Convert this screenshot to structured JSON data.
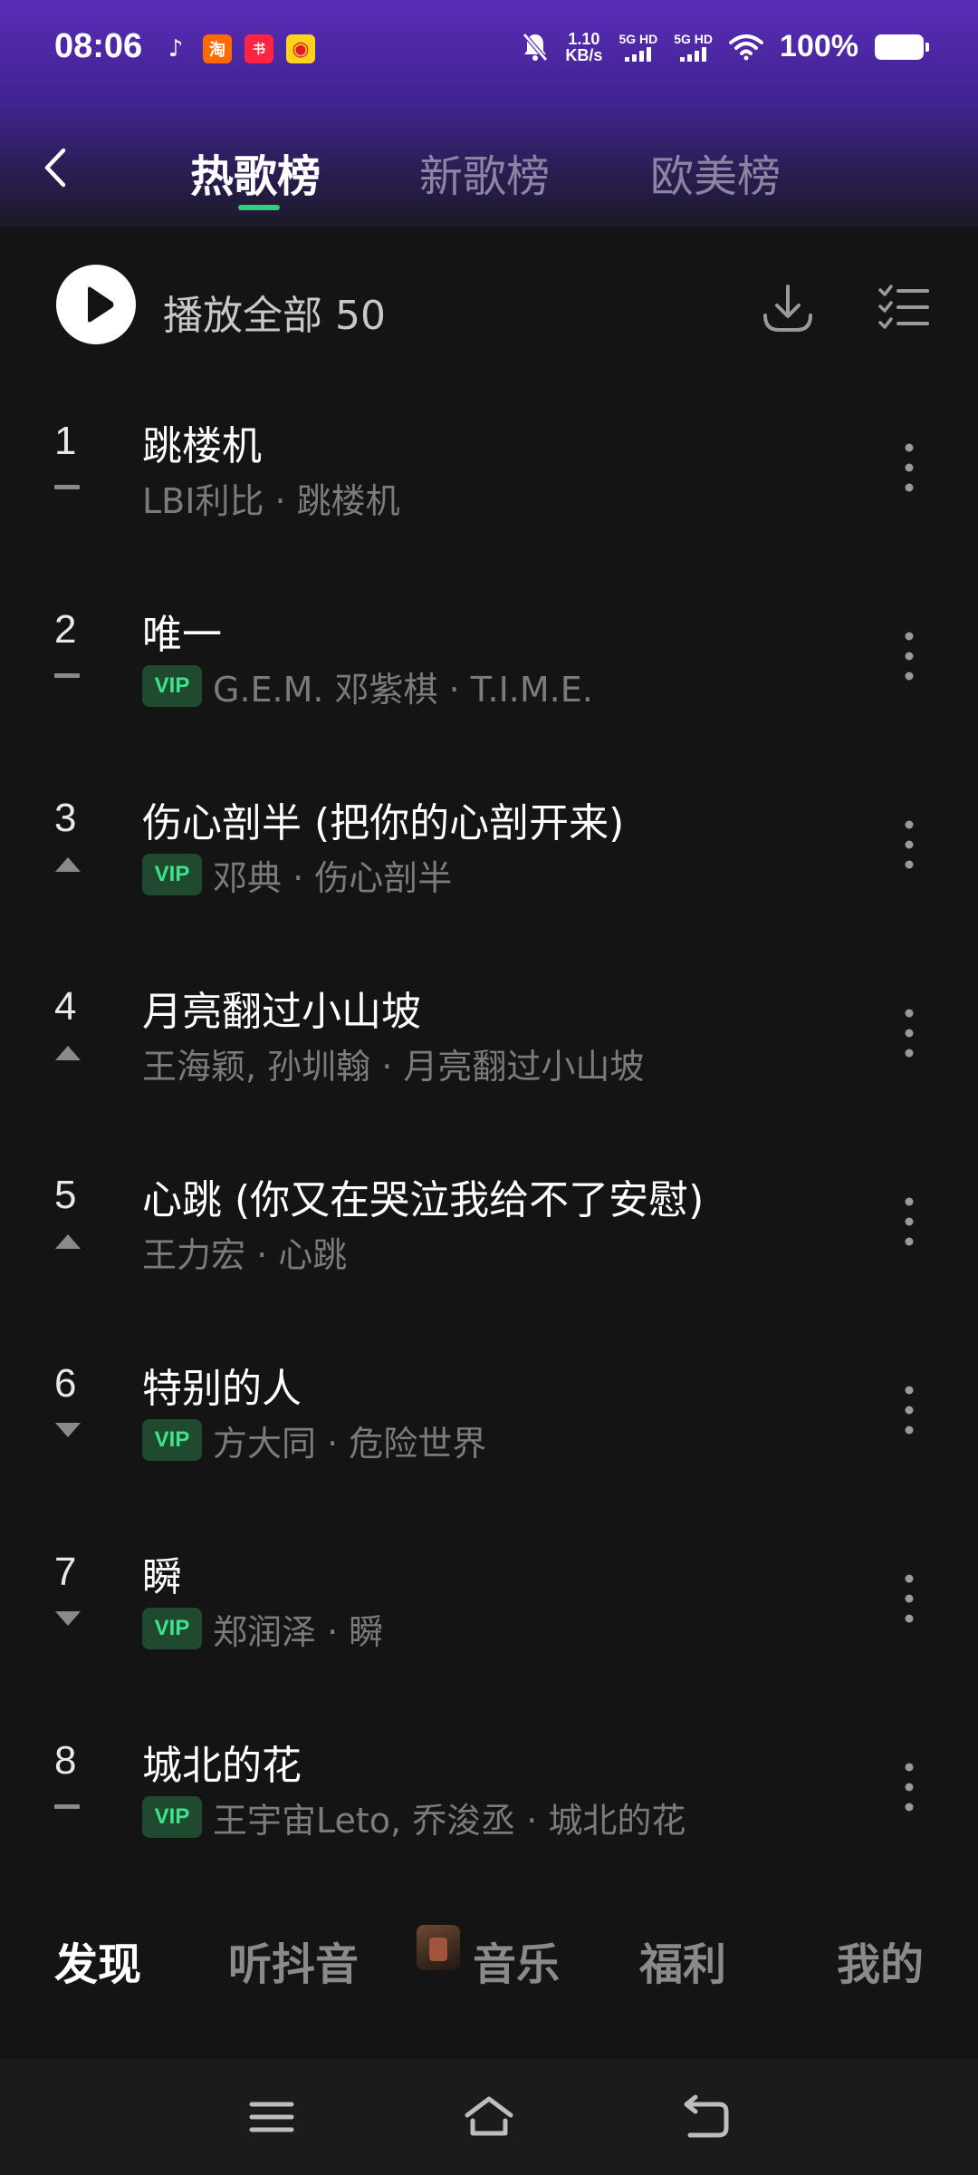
{
  "status_bar": {
    "time": "08:06",
    "apps": [
      {
        "name": "tiktok-icon",
        "glyph": "♪",
        "bg": "transparent",
        "color": "#ffffff"
      },
      {
        "name": "taobao-icon",
        "glyph": "淘",
        "bg": "#ff6a00",
        "color": "#ffffff"
      },
      {
        "name": "xiaohongshu-icon",
        "glyph": "书",
        "bg": "#ff2442",
        "color": "#ffffff"
      },
      {
        "name": "weibo-icon",
        "glyph": "◉",
        "bg": "#ffd21e",
        "color": "#e6162d"
      }
    ],
    "speed_value": "1.10",
    "speed_unit": "KB/s",
    "sim1": "5G HD",
    "sim2": "5G HD",
    "battery": "100%"
  },
  "tabs": [
    {
      "label": "热歌榜",
      "active": true
    },
    {
      "label": "新歌榜",
      "active": false
    },
    {
      "label": "欧美榜",
      "active": false
    }
  ],
  "play_all": {
    "label": "播放全部 50"
  },
  "songs": [
    {
      "rank": "1",
      "title": "跳楼机",
      "vip": false,
      "artist": "LBI利比 · 跳楼机",
      "trend": "flat"
    },
    {
      "rank": "2",
      "title": "唯一",
      "vip": true,
      "artist": "G.E.M. 邓紫棋 · T.I.M.E.",
      "trend": "flat"
    },
    {
      "rank": "3",
      "title": "伤心剖半 (把你的心剖开来)",
      "vip": true,
      "artist": "邓典 · 伤心剖半",
      "trend": "up"
    },
    {
      "rank": "4",
      "title": "月亮翻过小山坡",
      "vip": false,
      "artist": "王海颖, 孙圳翰 · 月亮翻过小山坡",
      "trend": "up"
    },
    {
      "rank": "5",
      "title": "心跳 (你又在哭泣我给不了安慰)",
      "vip": false,
      "artist": "王力宏 · 心跳",
      "trend": "up"
    },
    {
      "rank": "6",
      "title": "特别的人",
      "vip": true,
      "artist": "方大同 · 危险世界",
      "trend": "down"
    },
    {
      "rank": "7",
      "title": "瞬",
      "vip": true,
      "artist": "郑润泽 · 瞬",
      "trend": "down"
    },
    {
      "rank": "8",
      "title": "城北的花",
      "vip": true,
      "artist": "王宇宙Leto, 乔浚丞 · 城北的花",
      "trend": "flat"
    }
  ],
  "vip_label": "VIP",
  "bottom_nav": [
    {
      "label": "发现",
      "active": true
    },
    {
      "label": "听抖音",
      "active": false
    },
    {
      "label": "音乐",
      "active": false
    },
    {
      "label": "福利",
      "active": false
    },
    {
      "label": "我的",
      "active": false
    }
  ],
  "colors": {
    "accent": "#2ecf7c",
    "vip_text": "#3ee48a",
    "vip_bg": "#1f4a30",
    "background": "#141414",
    "header_top": "#5a2cb8"
  }
}
